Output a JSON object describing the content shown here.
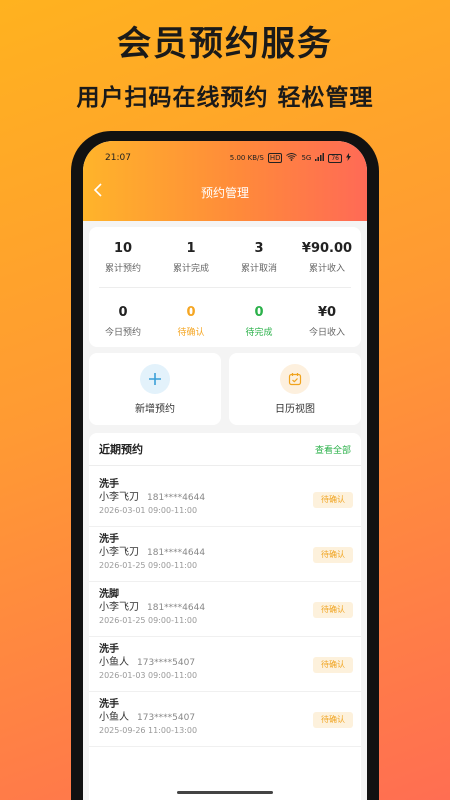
{
  "promo": {
    "title": "会员预约服务",
    "subtitle": "用户扫码在线预约 轻松管理"
  },
  "statusbar": {
    "time": "21:07",
    "net_speed": "5.00 KB/S",
    "hd": "HD",
    "signal": "5G",
    "battery": "76"
  },
  "navbar": {
    "title": "预约管理",
    "back_icon": "chevron-left-icon"
  },
  "stats": {
    "row1": [
      {
        "value": "10",
        "label": "累计预约"
      },
      {
        "value": "1",
        "label": "累计完成"
      },
      {
        "value": "3",
        "label": "累计取消"
      },
      {
        "value": "¥90.00",
        "label": "累计收入"
      }
    ],
    "row2": [
      {
        "value": "0",
        "label": "今日预约"
      },
      {
        "value": "0",
        "label": "待确认",
        "color": "#f5a623"
      },
      {
        "value": "0",
        "label": "待完成",
        "color": "#2bb14a"
      },
      {
        "value": "¥0",
        "label": "今日收入"
      }
    ]
  },
  "actions": {
    "new_booking": {
      "label": "新增预约",
      "icon": "plus-icon",
      "color": "#3a9fd8"
    },
    "calendar_view": {
      "label": "日历视图",
      "icon": "calendar-check-icon",
      "color": "#f0a31e"
    }
  },
  "recent": {
    "title": "近期预约",
    "view_all": "查看全部",
    "rows": [
      {
        "service": "洗手",
        "name": "小李飞刀",
        "phone": "181****4644",
        "time": "2026-03-01 09:00-11:00",
        "status": "待确认"
      },
      {
        "service": "洗手",
        "name": "小李飞刀",
        "phone": "181****4644",
        "time": "2026-01-25 09:00-11:00",
        "status": "待确认"
      },
      {
        "service": "洗脚",
        "name": "小李飞刀",
        "phone": "181****4644",
        "time": "2026-01-25 09:00-11:00",
        "status": "待确认"
      },
      {
        "service": "洗手",
        "name": "小鱼人",
        "phone": "173****5407",
        "time": "2026-01-03 09:00-11:00",
        "status": "待确认"
      },
      {
        "service": "洗手",
        "name": "小鱼人",
        "phone": "173****5407",
        "time": "2025-09-26 11:00-13:00",
        "status": "待确认"
      }
    ]
  },
  "colors": {
    "accent_orange": "#ff9a33",
    "accent_green": "#2bb14a",
    "pending_badge": "#f0a31e"
  }
}
